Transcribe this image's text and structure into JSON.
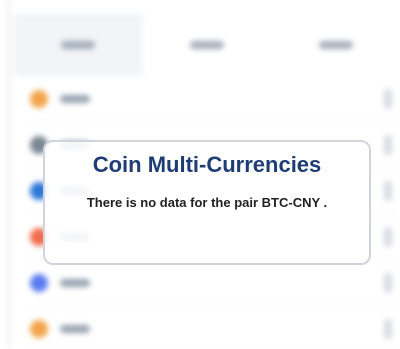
{
  "tabs": [
    {
      "active": true
    },
    {
      "active": false
    },
    {
      "active": false
    }
  ],
  "rows": [
    {
      "icon_color": "#f2a54a"
    },
    {
      "icon_color": "#7c8794"
    },
    {
      "icon_color": "#2b78d6"
    },
    {
      "icon_color": "#f26b4d"
    },
    {
      "icon_color": "#5b7cf0"
    },
    {
      "icon_color": "#f2a54a"
    }
  ],
  "overlay": {
    "title": "Coin Multi-Currencies",
    "message": "There is no data for the pair BTC-CNY ."
  },
  "colors": {
    "title": "#1f3d74",
    "border": "#cfd4dd",
    "text": "#222222"
  }
}
